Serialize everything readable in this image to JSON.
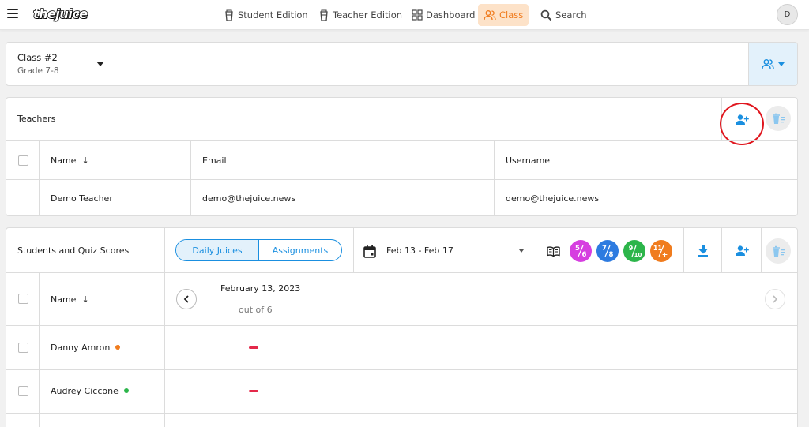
{
  "app": {
    "logo": "thejuice"
  },
  "nav": {
    "items": [
      {
        "label": "Student Edition",
        "icon": "cup-icon"
      },
      {
        "label": "Teacher Edition",
        "icon": "cup-icon"
      },
      {
        "label": "Dashboard",
        "icon": "grid-icon"
      },
      {
        "label": "Class",
        "icon": "users-icon",
        "active": true
      },
      {
        "label": "Search",
        "icon": "search-icon"
      }
    ],
    "avatar": "D",
    "active_color": "#f07c1e"
  },
  "class_selector": {
    "name": "Class #2",
    "grade": "Grade 7-8"
  },
  "teachers": {
    "title": "Teachers",
    "columns": [
      "Name",
      "Email",
      "Username"
    ],
    "rows": [
      {
        "name": "Demo Teacher",
        "email": "demo@thejuice.news",
        "username": "demo@thejuice.news"
      }
    ]
  },
  "students": {
    "title": "Students and Quiz Scores",
    "toggle": [
      "Daily Juices",
      "Assignments"
    ],
    "date_range": "Feb 13 - Feb 17",
    "grade_levels": [
      {
        "label_top": "5",
        "label_bottom": "6",
        "color": "#d63ee0"
      },
      {
        "label_top": "7",
        "label_bottom": "8",
        "color": "#2d7be0"
      },
      {
        "label_top": "9",
        "label_bottom": "10",
        "color": "#2cb54a"
      },
      {
        "label_top": "11",
        "label_bottom": "+",
        "color": "#f07c1e"
      }
    ],
    "name_column": "Name",
    "day": {
      "date": "February 13, 2023",
      "subtitle": "out of 6"
    },
    "rows": [
      {
        "name": "Danny Amron",
        "status_color": "#f07c1e"
      },
      {
        "name": "Audrey Ciccone",
        "status_color": "#2cb54a"
      }
    ]
  },
  "colors": {
    "accent": "#1a8fe0",
    "annotation": "#e0161e",
    "missing_score": "#e4294a"
  }
}
